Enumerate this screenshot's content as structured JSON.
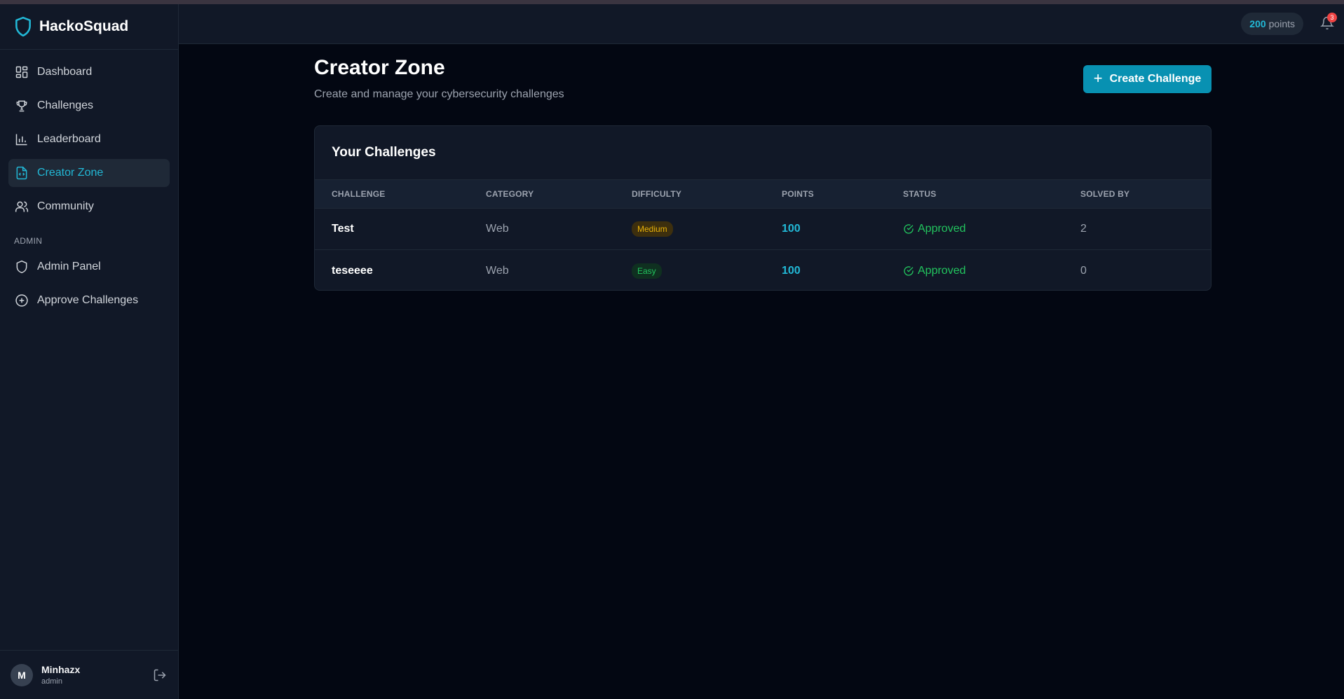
{
  "app": {
    "name": "HackoSquad"
  },
  "sidebar": {
    "items": [
      {
        "label": "Dashboard",
        "icon": "dashboard-icon"
      },
      {
        "label": "Challenges",
        "icon": "trophy-icon"
      },
      {
        "label": "Leaderboard",
        "icon": "bar-chart-icon"
      },
      {
        "label": "Creator Zone",
        "icon": "file-code-icon",
        "active": true
      },
      {
        "label": "Community",
        "icon": "users-icon"
      }
    ],
    "admin_heading": "ADMIN",
    "admin_items": [
      {
        "label": "Admin Panel",
        "icon": "shield-icon"
      },
      {
        "label": "Approve Challenges",
        "icon": "plus-circle-icon"
      }
    ]
  },
  "user": {
    "initial": "M",
    "name": "Minhazx",
    "role": "admin"
  },
  "header": {
    "points_value": "200",
    "points_label": "points",
    "notification_count": "3"
  },
  "page": {
    "title": "Creator Zone",
    "subtitle": "Create and manage your cybersecurity challenges",
    "create_button": "Create Challenge"
  },
  "challenges": {
    "title": "Your Challenges",
    "columns": [
      "CHALLENGE",
      "CATEGORY",
      "DIFFICULTY",
      "POINTS",
      "STATUS",
      "SOLVED BY"
    ],
    "rows": [
      {
        "name": "Test",
        "category": "Web",
        "difficulty": "Medium",
        "points": "100",
        "status": "Approved",
        "solved_by": "2"
      },
      {
        "name": "teseeee",
        "category": "Web",
        "difficulty": "Easy",
        "points": "100",
        "status": "Approved",
        "solved_by": "0"
      }
    ]
  },
  "colors": {
    "accent": "#22b8d6",
    "button": "#0891b2",
    "approved": "#22c55e",
    "medium": "#eab308",
    "easy": "#22c55e"
  }
}
